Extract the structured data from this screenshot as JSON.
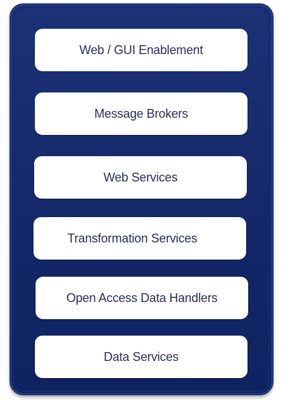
{
  "layers": [
    "Web / GUI Enablement",
    "Message Brokers",
    "Web Services",
    "Transformation Services",
    "Open Access Data Handlers",
    "Data Services"
  ]
}
